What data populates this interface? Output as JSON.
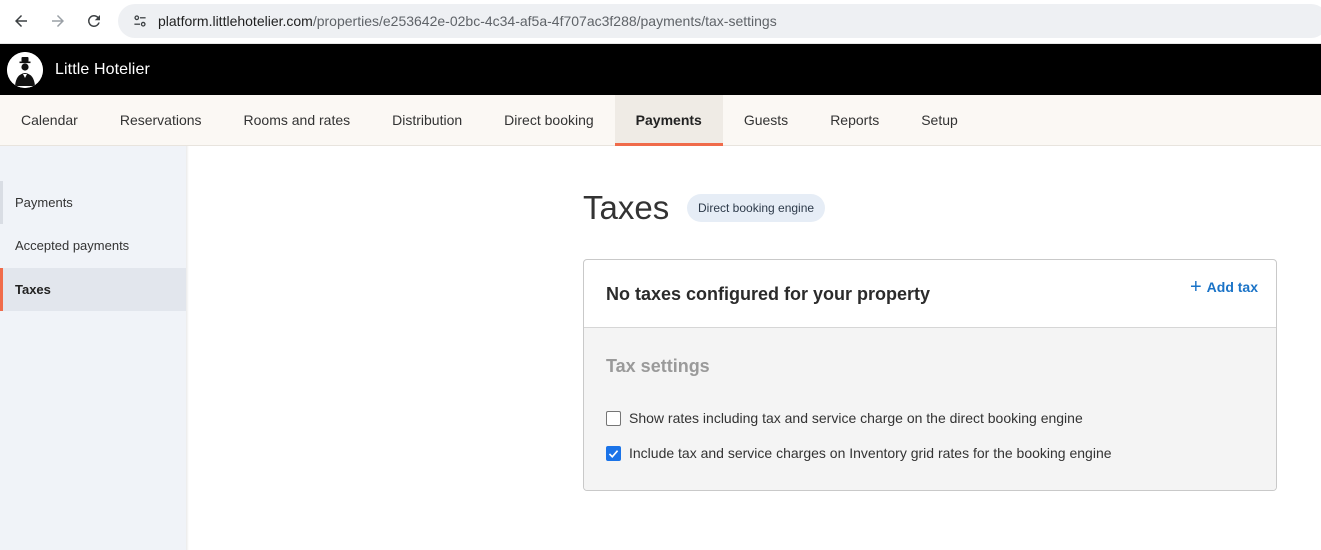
{
  "browser": {
    "url_host": "platform.littlehotelier.com",
    "url_path": "/properties/e253642e-02bc-4c34-af5a-4f707ac3f288/payments/tax-settings"
  },
  "app": {
    "title": "Little Hotelier"
  },
  "main_nav": {
    "tabs": [
      {
        "label": "Calendar"
      },
      {
        "label": "Reservations"
      },
      {
        "label": "Rooms and rates"
      },
      {
        "label": "Distribution"
      },
      {
        "label": "Direct booking"
      },
      {
        "label": "Payments",
        "active": true
      },
      {
        "label": "Guests"
      },
      {
        "label": "Reports"
      },
      {
        "label": "Setup"
      }
    ]
  },
  "sidebar": {
    "items": [
      {
        "label": "Payments"
      },
      {
        "label": "Accepted payments"
      },
      {
        "label": "Taxes",
        "active": true
      }
    ]
  },
  "page": {
    "title": "Taxes",
    "badge": "Direct booking engine"
  },
  "card": {
    "title": "No taxes configured for your property",
    "add_tax_label": "Add tax",
    "settings_title": "Tax settings",
    "options": [
      {
        "label": "Show rates including tax and service charge on the direct booking engine",
        "checked": false
      },
      {
        "label": "Include tax and service charges on Inventory grid rates for the booking engine",
        "checked": true
      }
    ]
  },
  "colors": {
    "accent": "#f06b4a",
    "link": "#1a73c7",
    "checkbox_checked": "#1a73e8",
    "header_bg": "#000000"
  }
}
